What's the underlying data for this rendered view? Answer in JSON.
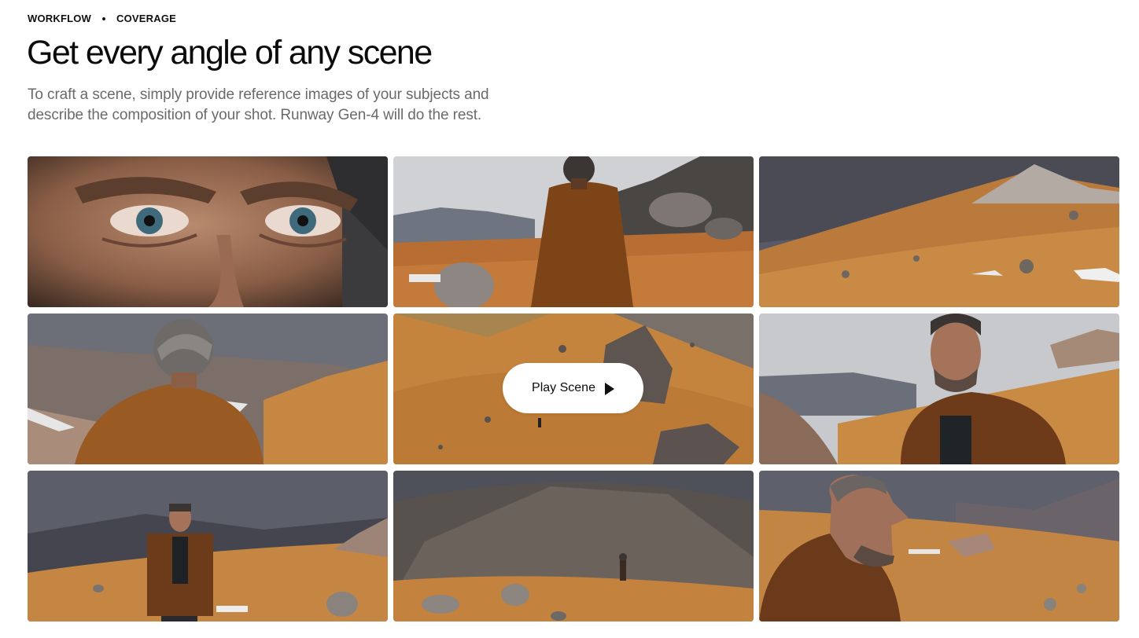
{
  "breadcrumb": {
    "items": [
      "WORKFLOW",
      "COVERAGE"
    ]
  },
  "header": {
    "title": "Get every angle of any scene",
    "subtitle": "To craft a scene, simply provide reference images of your subjects and describe the composition of your shot. Runway Gen-4 will do the rest."
  },
  "play_button": {
    "label": "Play Scene",
    "icon": "play-icon"
  },
  "colors": {
    "sky": "#8c8e96",
    "ground": "#c8873a",
    "jacket": "#7a4418",
    "rock": "#6e6762",
    "skin": "#a8785c"
  }
}
